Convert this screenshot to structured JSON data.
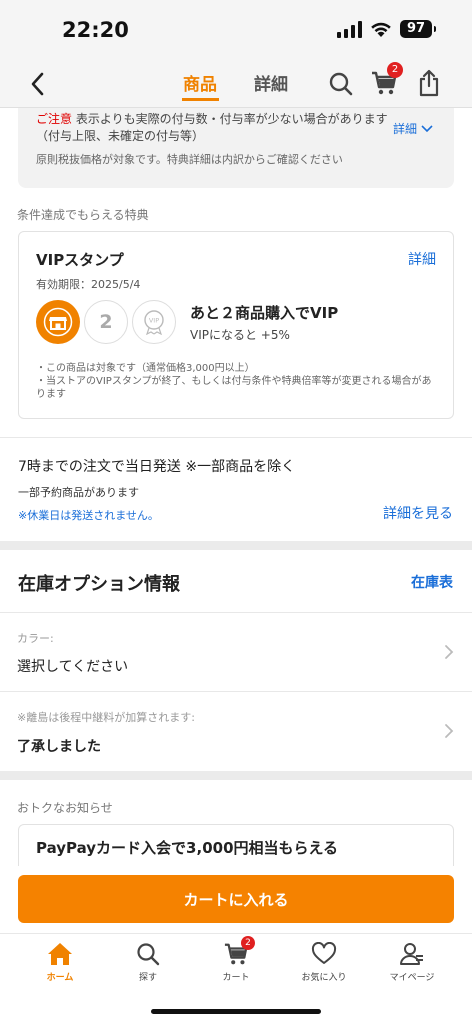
{
  "status_bar": {
    "time": "22:20",
    "battery": "97"
  },
  "nav": {
    "tabs": [
      {
        "label": "商品"
      },
      {
        "label": "詳細"
      }
    ],
    "cart_badge": "2"
  },
  "notice": {
    "label": "ご注意",
    "text": "表示よりも実際の付与数・付与率が少ない場合があります（付与上限、未確定の付与等）",
    "detail_link": "詳細",
    "footnote": "原則税抜価格が対象です。特典詳細は内訳からご確認ください"
  },
  "conditions": {
    "section_label": "条件達成でもらえる特典",
    "vip": {
      "title": "VIPスタンプ",
      "detail_link": "詳細",
      "expiry": "有効期限：2025/5/4",
      "stamp_number": "2",
      "stamp_badge": "VIP",
      "progress": "あと２商品購入でVIP",
      "bonus": "VIPになると +5%",
      "notes": [
        "・この商品は対象です（通常価格3,000円以上）",
        "・当ストアのVIPスタンプが終了、もしくは付与条件や特典倍率等が変更される場合があります"
      ]
    }
  },
  "shipping": {
    "title": "7時までの注文で当日発送 ※一部商品を除く",
    "subtitle": "一部予約商品があります",
    "holiday_note": "※休業日は発送されません。",
    "detail_link": "詳細を見る"
  },
  "stock": {
    "title": "在庫オプション情報",
    "table_link": "在庫表",
    "options": [
      {
        "label": "カラー:",
        "value": "選択してください"
      },
      {
        "label": "※離島は後程中継料が加算されます:",
        "value": "了承しました"
      }
    ]
  },
  "deals": {
    "section_label": "おトクなお知らせ",
    "paypay_title": "PayPayカード入会で3,000円相当もらえる"
  },
  "cart_button": "カートに入れる",
  "tabbar": {
    "items": [
      {
        "label": "ホーム"
      },
      {
        "label": "探す"
      },
      {
        "label": "カート"
      },
      {
        "label": "お気に入り"
      },
      {
        "label": "マイページ"
      }
    ],
    "cart_badge": "2"
  },
  "colors": {
    "accent": "#f08200",
    "link": "#1a6ed8",
    "badge": "#e02020"
  }
}
